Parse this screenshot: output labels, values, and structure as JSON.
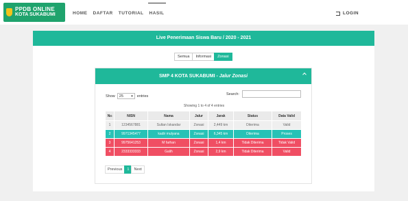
{
  "logo": {
    "line1": "PPDB ONLINE",
    "line2": "KOTA SUKABUMI"
  },
  "nav": {
    "items": [
      "HOME",
      "DAFTAR",
      "TUTORIAL",
      "HASIL"
    ],
    "login": "LOGIN"
  },
  "card": {
    "title": "Live Penerimaan Siswa Baru / 2020 - 2021"
  },
  "filter": {
    "buttons": [
      "Semua",
      "Informasi",
      "Zonasi"
    ],
    "active": "Zonasi"
  },
  "panel": {
    "school": "SMP 4 KOTA SUKABUMI -",
    "route": "Jalur Zonasi",
    "show_label": "Show",
    "page_size": "25",
    "entries_label": "entries",
    "search_label": "Search:",
    "info": "Showing 1 to 4 of 4 entries"
  },
  "table": {
    "headers": [
      "No",
      "NISN",
      "Nama",
      "Jalur",
      "Jarak",
      "Status",
      "Data Valid"
    ],
    "rows": [
      {
        "cells": [
          "1",
          "1234567881",
          "Sultan Iskandar",
          "Zonasi",
          "2,449 km",
          "Diterima",
          "Valid"
        ],
        "style": "row-gray"
      },
      {
        "cells": [
          "2",
          "9971345477",
          "kadir mulyana",
          "Zonasi",
          "6,345 km",
          "Diterima",
          "Proses"
        ],
        "style": "row-teal"
      },
      {
        "cells": [
          "3",
          "9975641253",
          "M farhan",
          "Zonasi",
          "1,4 km",
          "Tidak Diterima",
          "Tidak Valid"
        ],
        "style": "row-red"
      },
      {
        "cells": [
          "4",
          "2333333333",
          "Galih",
          "Zonasi",
          "2,9 km",
          "Tidak Diterima",
          "Valid"
        ],
        "style": "row-red"
      }
    ]
  },
  "pager": {
    "previous": "Previous",
    "current": "1",
    "next": "Next"
  },
  "colors": {
    "brand": "#1fa36d",
    "teal": "#1fb89a",
    "row_teal": "#27c2b6",
    "row_red": "#f04e63"
  },
  "icons": {
    "login": "sign-in-icon",
    "collapse": "chevron-up-icon",
    "dropdown": "caret-down-icon"
  }
}
